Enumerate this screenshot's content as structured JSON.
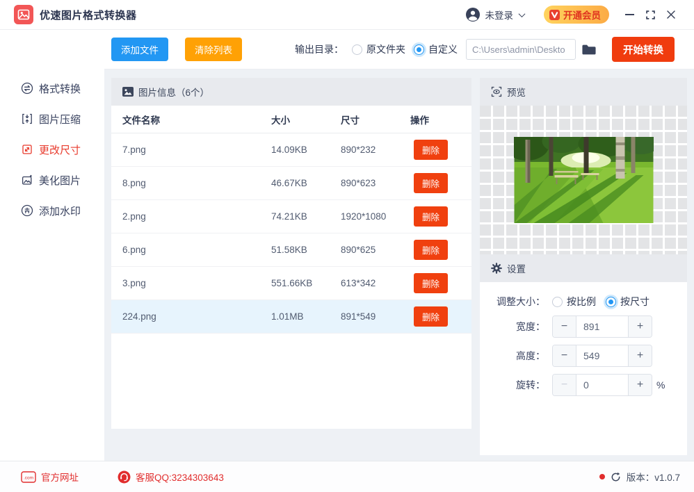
{
  "title_bar": {
    "app_title": "优速图片格式转换器",
    "login_label": "未登录",
    "vip_label": "开通会员"
  },
  "toolbar": {
    "add_files_label": "添加文件",
    "clear_list_label": "清除列表",
    "output_dir_label": "输出目录：",
    "radio_original_label": "原文件夹",
    "radio_custom_label": "自定义",
    "output_path_value": "C:\\Users\\admin\\Deskto",
    "start_convert_label": "开始转换"
  },
  "sidebar": {
    "items": [
      {
        "label": "格式转换",
        "active": false
      },
      {
        "label": "图片压缩",
        "active": false
      },
      {
        "label": "更改尺寸",
        "active": true
      },
      {
        "label": "美化图片",
        "active": false
      },
      {
        "label": "添加水印",
        "active": false
      }
    ]
  },
  "file_panel": {
    "header": "图片信息（6个）",
    "columns": {
      "name": "文件名称",
      "size": "大小",
      "dims": "尺寸",
      "ops": "操作"
    },
    "delete_label": "删除",
    "rows": [
      {
        "name": "7.png",
        "size": "14.09KB",
        "dims": "890*232",
        "selected": false
      },
      {
        "name": "8.png",
        "size": "46.67KB",
        "dims": "890*623",
        "selected": false
      },
      {
        "name": "2.png",
        "size": "74.21KB",
        "dims": "1920*1080",
        "selected": false
      },
      {
        "name": "6.png",
        "size": "51.58KB",
        "dims": "890*625",
        "selected": false
      },
      {
        "name": "3.png",
        "size": "551.66KB",
        "dims": "613*342",
        "selected": false
      },
      {
        "name": "224.png",
        "size": "1.01MB",
        "dims": "891*549",
        "selected": true
      }
    ]
  },
  "preview_panel": {
    "header": "预览"
  },
  "settings_panel": {
    "header": "设置",
    "resize_label": "调整大小：",
    "radio_ratio_label": "按比例",
    "radio_size_label": "按尺寸",
    "width_label": "宽度：",
    "width_value": "891",
    "height_label": "高度：",
    "height_value": "549",
    "rotate_label": "旋转：",
    "rotate_value": "0",
    "rotate_unit": "%",
    "minus_glyph": "−",
    "plus_glyph": "+"
  },
  "footer": {
    "website_label": "官方网址",
    "qq_label": "客服QQ:3234303643",
    "version_label": "版本：v1.0.7",
    "com_icon_label": ".com"
  },
  "colors": {
    "accent_blue": "#2297f3",
    "accent_orange": "#ffa105",
    "accent_red": "#f03c0e",
    "active_nav_red": "#e83a2c",
    "footer_red": "#e12d2d",
    "selected_row_bg": "#e7f4fd",
    "panel_header_bg": "#e8eaee",
    "content_bg": "#eef1f5"
  }
}
